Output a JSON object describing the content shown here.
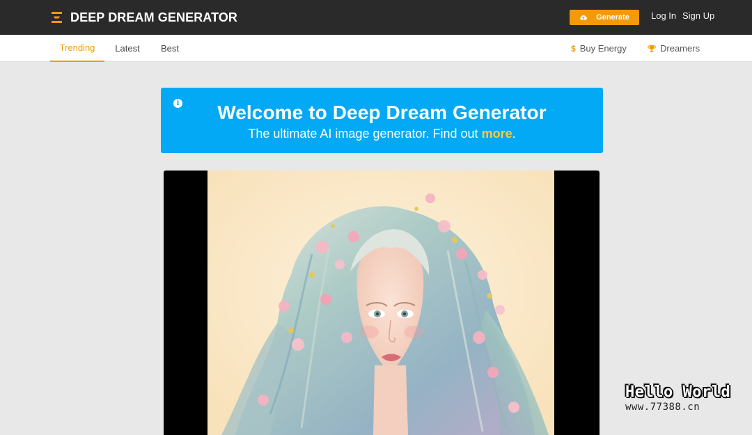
{
  "header": {
    "brand": "DEEP DREAM GENERATOR",
    "logo_icon": "stacked-bars-logo-icon",
    "generate_label": "Generate",
    "generate_icon": "cloud-upload-icon",
    "login_label": "Log In",
    "signup_label": "Sign Up"
  },
  "subnav": {
    "tabs": [
      {
        "label": "Trending",
        "active": true
      },
      {
        "label": "Latest",
        "active": false
      },
      {
        "label": "Best",
        "active": false
      }
    ],
    "buy_energy": {
      "label": "Buy Energy",
      "icon": "dollar-icon"
    },
    "dreamers": {
      "label": "Dreamers",
      "icon": "trophy-icon"
    }
  },
  "banner": {
    "info_icon": "info-icon",
    "title": "Welcome to Deep Dream Generator",
    "subtitle_prefix": "The ultimate AI image generator. Find out ",
    "subtitle_link": "more",
    "subtitle_suffix": "."
  },
  "feed": {
    "image": "ai-portrait-girl-with-pastel-hair-and-flowers"
  },
  "watermark": {
    "title": "Hello World",
    "url": "www.77388.cn"
  },
  "colors": {
    "topbar": "#2a2a2a",
    "accent": "#f39a0b",
    "banner": "#03a9f4",
    "link_highlight": "#ffca3a",
    "page_bg": "#e8e8e8"
  }
}
